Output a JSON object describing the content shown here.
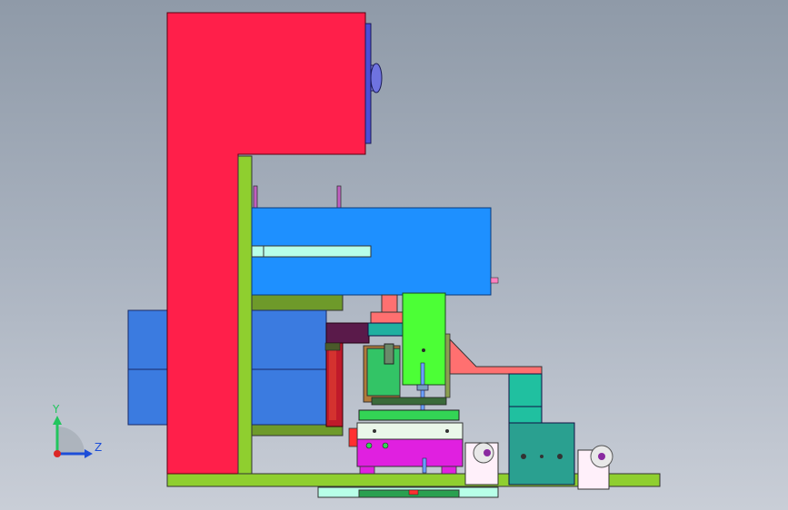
{
  "axes": {
    "y_label": "Y",
    "z_label": "Z",
    "y_color": "#22c55e",
    "z_color": "#1d4ed8",
    "origin_color": "#dc2626"
  },
  "colors": {
    "frame_red": "#ff1f4a",
    "base_green": "#8fcf2f",
    "blue_block": "#1e90ff",
    "side_blue": "#3b7be0",
    "light_cyan": "#b8ffe8",
    "green_arm": "#4cff36",
    "magenta_block": "#e020e0",
    "teal_bracket": "#20c0a0",
    "salmon": "#ff7070",
    "olive": "#7a9a2a",
    "background_top": "#8f9aa8",
    "background_bottom": "#c9ced7"
  }
}
